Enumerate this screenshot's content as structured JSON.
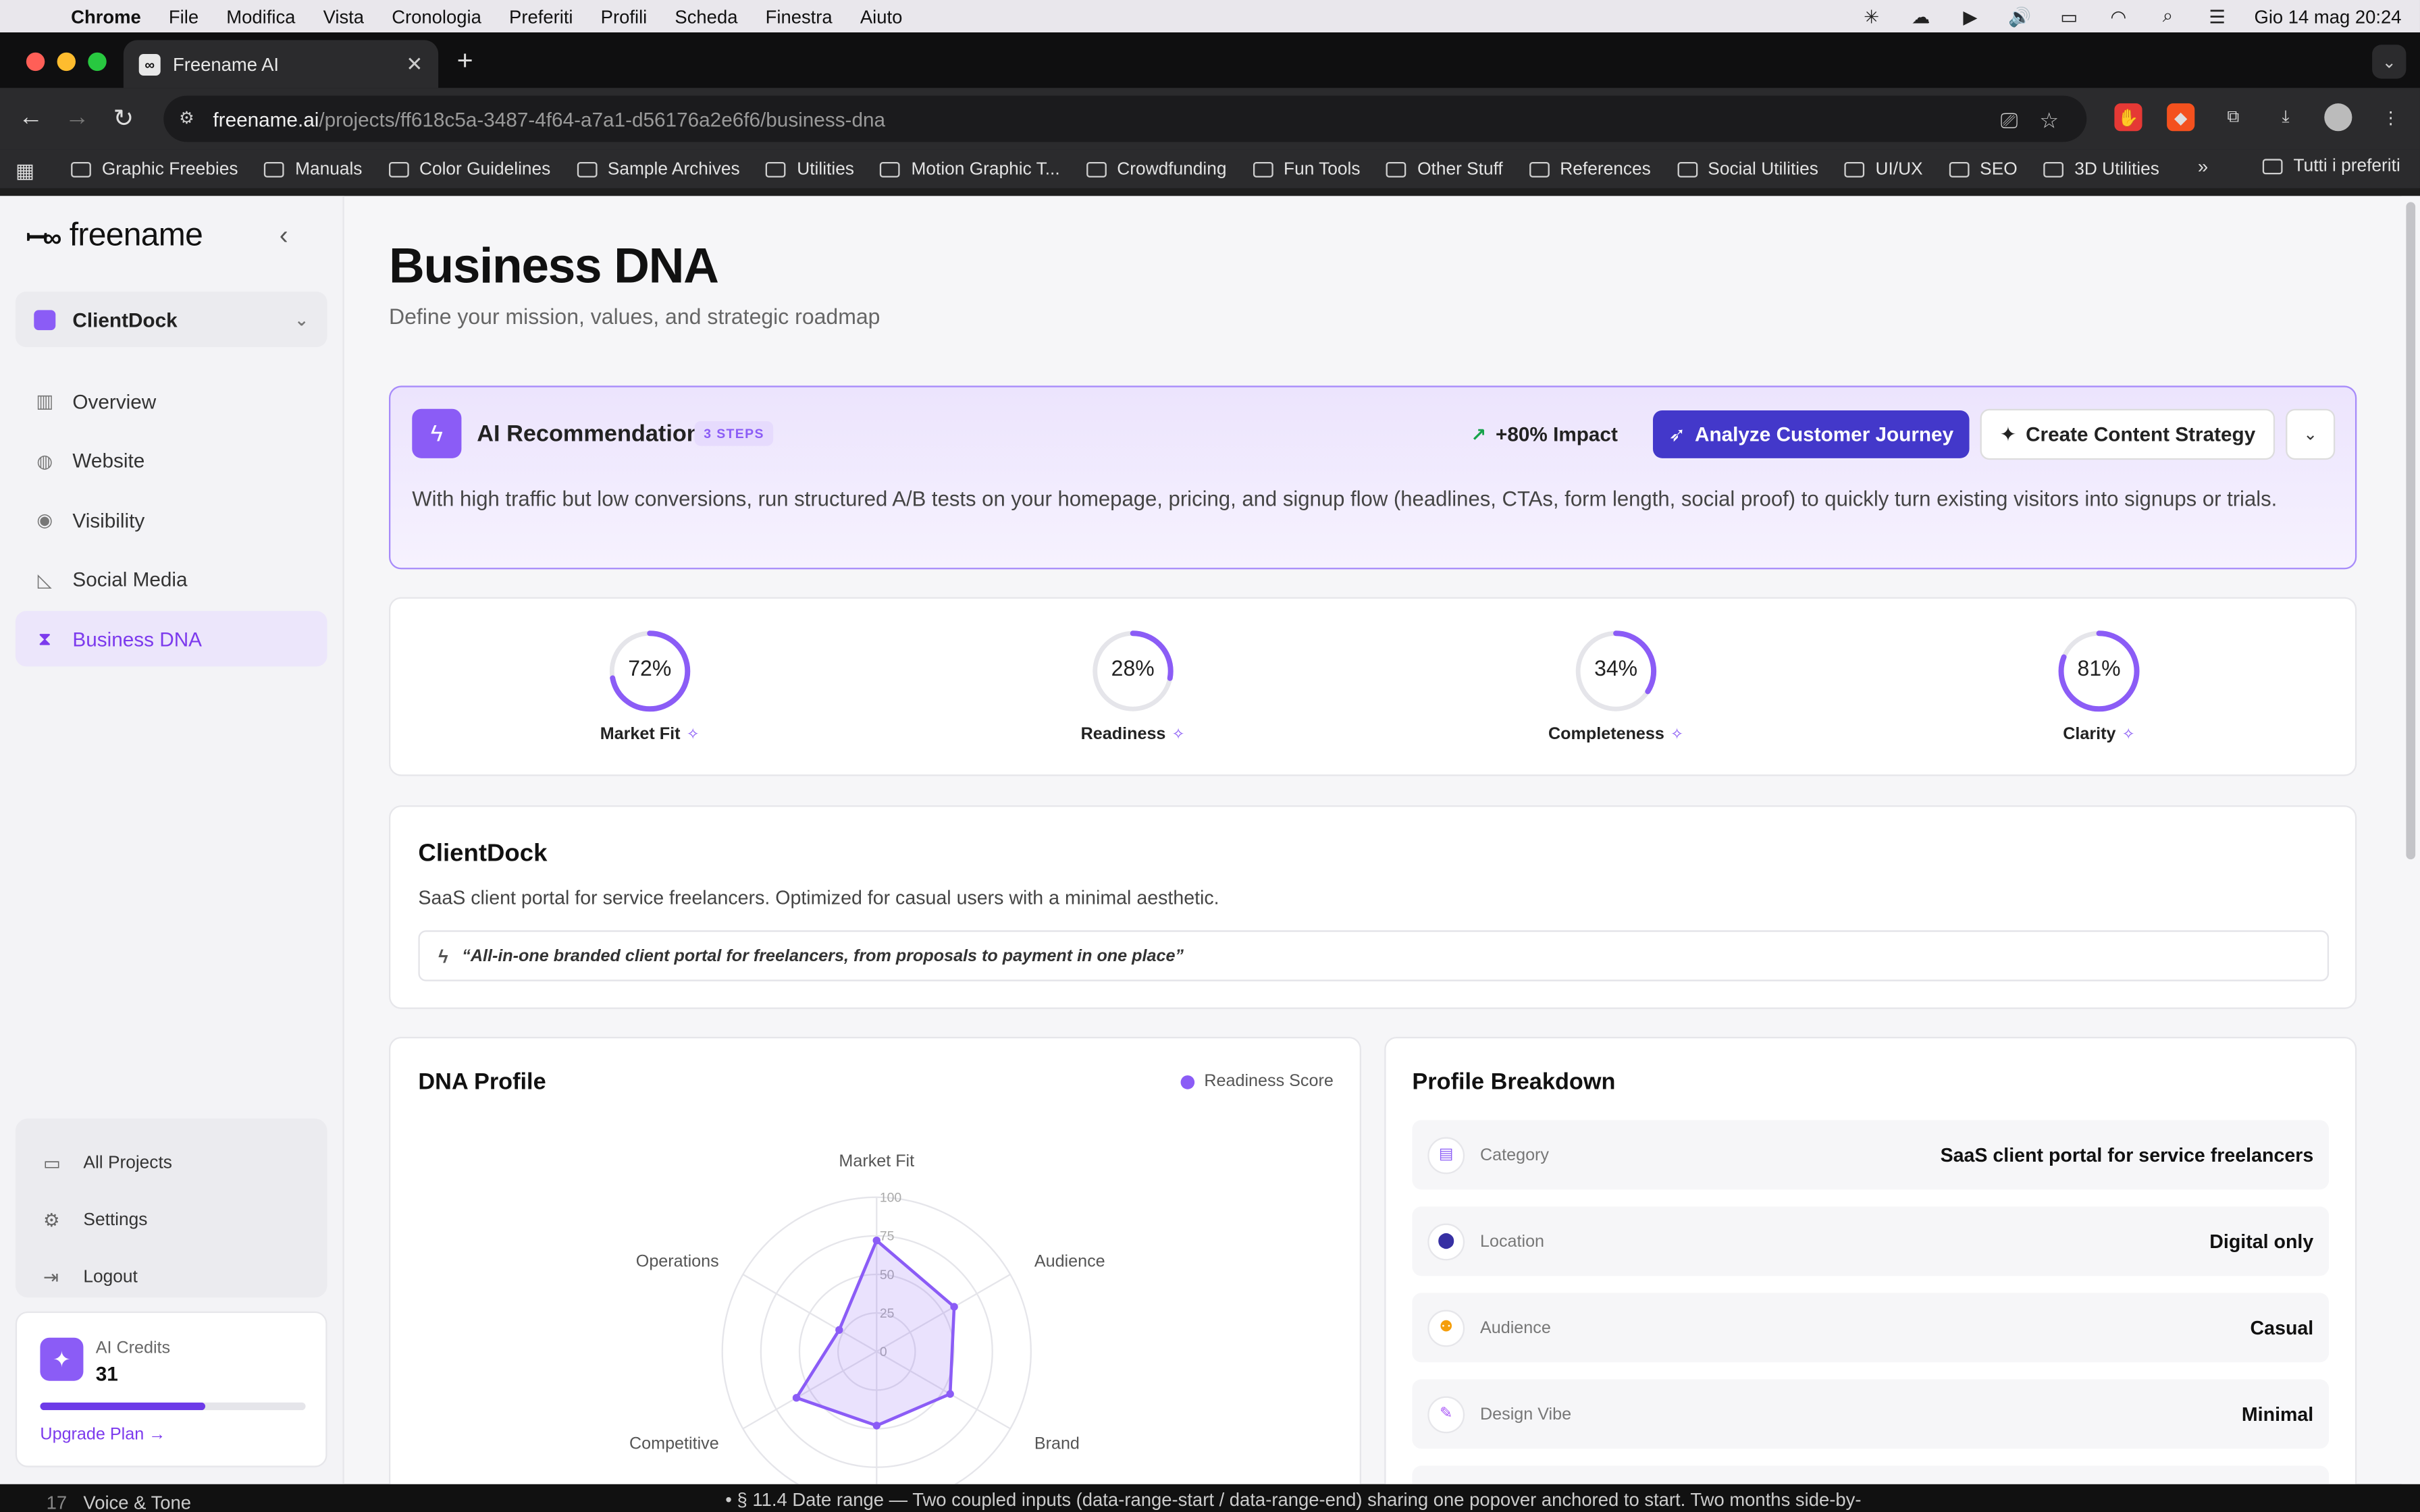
{
  "menubar": {
    "app": "Chrome",
    "items": [
      "File",
      "Modifica",
      "Vista",
      "Cronologia",
      "Preferiti",
      "Profili",
      "Scheda",
      "Finestra",
      "Aiuto"
    ],
    "datetime": "Gio 14 mag  20:24"
  },
  "browser": {
    "tab_title": "Freename AI",
    "url_host": "freename.ai",
    "url_path": "/projects/ff618c5a-3487-4f64-a7a1-d56176a2e6f6/business-dna",
    "bookmarks": [
      "Graphic Freebies",
      "Manuals",
      "Color Guidelines",
      "Sample Archives",
      "Utilities",
      "Motion Graphic T...",
      "Crowdfunding",
      "Fun Tools",
      "Other Stuff",
      "References",
      "Social Utilities",
      "UI/UX",
      "SEO",
      "3D Utilities"
    ],
    "all_bookmarks": "Tutti i preferiti"
  },
  "sidebar": {
    "brand": "freename",
    "project": "ClientDock",
    "nav": [
      {
        "label": "Overview",
        "icon": "bar-chart-icon"
      },
      {
        "label": "Website",
        "icon": "globe-icon"
      },
      {
        "label": "Visibility",
        "icon": "eye-icon"
      },
      {
        "label": "Social Media",
        "icon": "megaphone-icon"
      },
      {
        "label": "Business DNA",
        "icon": "dna-icon",
        "active": true
      }
    ],
    "bottom": [
      {
        "label": "All Projects",
        "icon": "folder-icon"
      },
      {
        "label": "Settings",
        "icon": "gear-icon"
      },
      {
        "label": "Logout",
        "icon": "logout-icon"
      }
    ],
    "credits": {
      "label": "AI Credits",
      "value": "31",
      "progress": 0.62,
      "upgrade": "Upgrade Plan →"
    }
  },
  "page": {
    "title": "Business DNA",
    "subtitle": "Define your mission, values, and strategic roadmap"
  },
  "recommendation": {
    "title": "AI Recommendation",
    "steps": "3 STEPS",
    "impact": "+80% Impact",
    "primary_action": "Analyze Customer Journey",
    "secondary_action": "Create Content Strategy",
    "text": "With high traffic but low conversions, run structured A/B tests on your homepage, pricing, and signup flow (headlines, CTAs, form length, social proof) to quickly turn existing visitors into signups or trials."
  },
  "metrics": [
    {
      "label": "Market Fit",
      "value": 72,
      "display": "72%"
    },
    {
      "label": "Readiness",
      "value": 28,
      "display": "28%"
    },
    {
      "label": "Completeness",
      "value": 34,
      "display": "34%"
    },
    {
      "label": "Clarity",
      "value": 81,
      "display": "81%"
    }
  ],
  "brand": {
    "name": "ClientDock",
    "description": "SaaS client portal for service freelancers. Optimized for casual users with a minimal aesthetic.",
    "tagline": "“All-in-one branded client portal for freelancers, from proposals to payment in one place”"
  },
  "dna_profile": {
    "title": "DNA Profile",
    "legend": "Readiness Score"
  },
  "chart_data": {
    "type": "radar",
    "axes": [
      "Market Fit",
      "Audience",
      "Brand",
      "",
      "Competitive",
      "Operations"
    ],
    "ticks": [
      "0",
      "25",
      "50",
      "75",
      "100"
    ],
    "range": [
      0,
      100
    ],
    "series": [
      {
        "name": "Readiness Score",
        "values": [
          72,
          58,
          55,
          48,
          60,
          28
        ]
      }
    ],
    "color": "#8b5cf6"
  },
  "profile_breakdown": {
    "title": "Profile Breakdown",
    "rows": [
      {
        "label": "Category",
        "value": "SaaS client portal for service freelancers",
        "icon": "store-icon"
      },
      {
        "label": "Location",
        "value": "Digital only",
        "icon": "location-pin-icon"
      },
      {
        "label": "Audience",
        "value": "Casual",
        "icon": "users-icon"
      },
      {
        "label": "Design Vibe",
        "value": "Minimal",
        "icon": "brush-icon"
      }
    ]
  },
  "below_fold": {
    "left_num": "17",
    "left_text": "Voice & Tone",
    "right_text": "• § 11.4 Date range — Two coupled inputs (data-range-start / data-range-end) sharing one popover anchored to start. Two months side-by-"
  },
  "colors": {
    "accent": "#8b5cf6",
    "primary_button": "#4338ca"
  }
}
